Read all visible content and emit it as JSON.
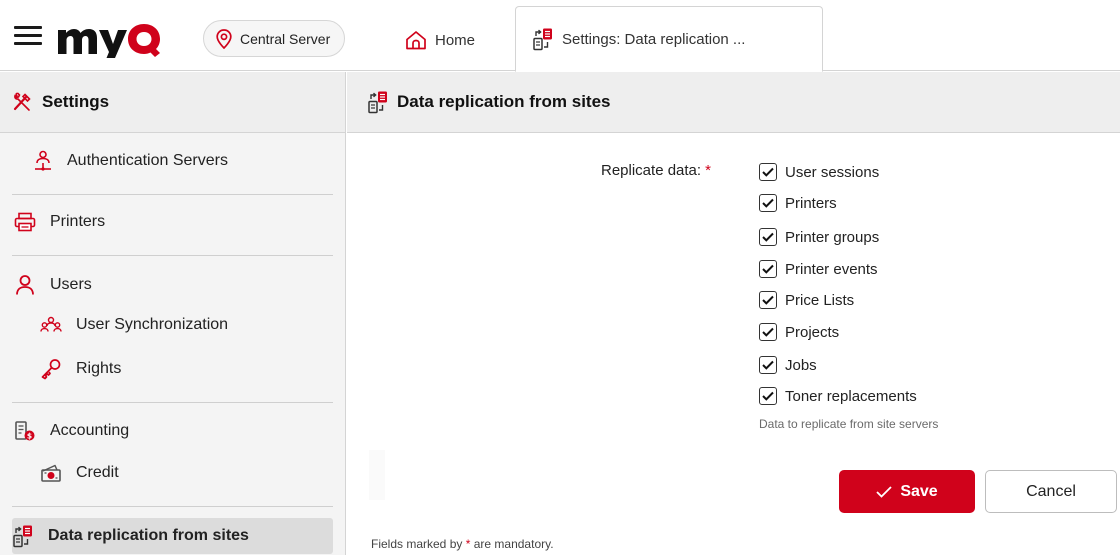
{
  "app": {
    "logo_text": "myQ",
    "brand_color": "#d0021b"
  },
  "topbar": {
    "server_label": "Central Server",
    "tabs": [
      {
        "label": "Home",
        "icon": "home-icon"
      },
      {
        "label": "Settings: Data replication ...",
        "icon": "data-replication-icon",
        "active": true
      }
    ]
  },
  "sidebar": {
    "title": "Settings",
    "title_icon": "settings-tools-icon",
    "items": [
      {
        "label": "Authentication Servers",
        "icon": "authentication-server-icon"
      },
      {
        "label": "Printers",
        "icon": "printer-icon"
      },
      {
        "label": "Users",
        "icon": "user-icon"
      },
      {
        "label": "User Synchronization",
        "icon": "user-sync-icon"
      },
      {
        "label": "Rights",
        "icon": "rights-icon"
      },
      {
        "label": "Accounting",
        "icon": "accounting-icon"
      },
      {
        "label": "Credit",
        "icon": "credit-icon"
      },
      {
        "label": "Data replication from sites",
        "icon": "data-replication-icon",
        "active": true
      }
    ]
  },
  "main": {
    "title": "Data replication from sites",
    "form": {
      "label": "Replicate data:",
      "required_mark": "*",
      "options": [
        {
          "label": "User sessions",
          "checked": true
        },
        {
          "label": "Printers",
          "checked": true
        },
        {
          "label": "Printer groups",
          "checked": true
        },
        {
          "label": "Printer events",
          "checked": true
        },
        {
          "label": "Price Lists",
          "checked": true
        },
        {
          "label": "Projects",
          "checked": true
        },
        {
          "label": "Jobs",
          "checked": true
        },
        {
          "label": "Toner replacements",
          "checked": true
        }
      ],
      "hint": "Data to replicate from site servers"
    },
    "save_label": "Save",
    "cancel_label": "Cancel",
    "footnote_prefix": "Fields marked by",
    "footnote_mark": "*",
    "footnote_suffix": "are mandatory."
  }
}
